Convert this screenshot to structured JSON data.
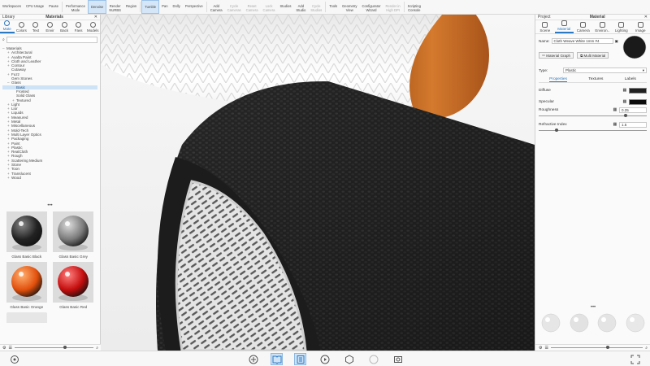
{
  "toolbar": {
    "items": [
      {
        "label": "Workspaces",
        "state": "normal"
      },
      {
        "label": "CPU Usage",
        "state": "normal"
      },
      {
        "label": "Pause",
        "state": "normal"
      },
      {
        "label": "Performance\nMode",
        "state": "normal"
      },
      {
        "label": "Denoise",
        "state": "active"
      },
      {
        "label": "Render\nNURBS",
        "state": "normal"
      },
      {
        "label": "Region",
        "state": "normal"
      },
      {
        "label": "Tumble",
        "state": "active"
      },
      {
        "label": "Pan",
        "state": "normal"
      },
      {
        "label": "Dolly",
        "state": "normal"
      },
      {
        "label": "Perspective",
        "state": "normal"
      },
      {
        "label": "Add\nCamera",
        "state": "normal"
      },
      {
        "label": "Cycle\nCameras",
        "state": "dim"
      },
      {
        "label": "Reset\nCamera",
        "state": "dim"
      },
      {
        "label": "Lock\nCamera",
        "state": "dim"
      },
      {
        "label": "Studios",
        "state": "normal"
      },
      {
        "label": "Add\nStudio",
        "state": "normal"
      },
      {
        "label": "Cycle\nStudios",
        "state": "dim"
      },
      {
        "label": "Tools",
        "state": "normal"
      },
      {
        "label": "Geometry\nView",
        "state": "normal"
      },
      {
        "label": "Configurator\nWizard",
        "state": "normal"
      },
      {
        "label": "Render in\nHigh DPI",
        "state": "dim"
      },
      {
        "label": "Scripting\nConsole",
        "state": "normal"
      }
    ]
  },
  "library": {
    "header": "Library",
    "title": "Materials",
    "tabs": [
      {
        "label": "Mate",
        "active": true
      },
      {
        "label": "Colors",
        "active": false
      },
      {
        "label": "Text",
        "active": false
      },
      {
        "label": "Envir",
        "active": false
      },
      {
        "label": "Back",
        "active": false
      },
      {
        "label": "Favs",
        "active": false
      },
      {
        "label": "Models",
        "active": false
      }
    ],
    "search_placeholder": "",
    "tree": [
      {
        "label": "Materials",
        "level": 0,
        "pm": "–",
        "sel": false
      },
      {
        "label": "Architectural",
        "level": 1,
        "pm": "+",
        "sel": false
      },
      {
        "label": "Axalta Paint",
        "level": 1,
        "pm": "+",
        "sel": false
      },
      {
        "label": "Cloth and Leather",
        "level": 1,
        "pm": "+",
        "sel": false
      },
      {
        "label": "Contour",
        "level": 1,
        "pm": "+",
        "sel": false
      },
      {
        "label": "Cutaway",
        "level": 1,
        "pm": "",
        "sel": false
      },
      {
        "label": "Fuzz",
        "level": 1,
        "pm": "+",
        "sel": false
      },
      {
        "label": "Gem Stones",
        "level": 1,
        "pm": "",
        "sel": false
      },
      {
        "label": "Glass",
        "level": 1,
        "pm": "–",
        "sel": false
      },
      {
        "label": "Basic",
        "level": 2,
        "pm": "",
        "sel": true
      },
      {
        "label": "Frosted",
        "level": 2,
        "pm": "",
        "sel": false
      },
      {
        "label": "Solid Glass",
        "level": 2,
        "pm": "",
        "sel": false
      },
      {
        "label": "Textured",
        "level": 2,
        "pm": "+",
        "sel": false
      },
      {
        "label": "Light",
        "level": 1,
        "pm": "+",
        "sel": false
      },
      {
        "label": "Lior",
        "level": 1,
        "pm": "+",
        "sel": false
      },
      {
        "label": "Liquids",
        "level": 1,
        "pm": "+",
        "sel": false
      },
      {
        "label": "Measured",
        "level": 1,
        "pm": "+",
        "sel": false
      },
      {
        "label": "Metal",
        "level": 1,
        "pm": "+",
        "sel": false
      },
      {
        "label": "Miscellaneous",
        "level": 1,
        "pm": "+",
        "sel": false
      },
      {
        "label": "Mold-Tech",
        "level": 1,
        "pm": "+",
        "sel": false
      },
      {
        "label": "Multi Layer Optics",
        "level": 1,
        "pm": "+",
        "sel": false
      },
      {
        "label": "Packaging",
        "level": 1,
        "pm": "+",
        "sel": false
      },
      {
        "label": "Paint",
        "level": 1,
        "pm": "+",
        "sel": false
      },
      {
        "label": "Plastic",
        "level": 1,
        "pm": "+",
        "sel": false
      },
      {
        "label": "RealCloth",
        "level": 1,
        "pm": "+",
        "sel": false
      },
      {
        "label": "Rough",
        "level": 1,
        "pm": "+",
        "sel": false
      },
      {
        "label": "Scattering Medium",
        "level": 1,
        "pm": "+",
        "sel": false
      },
      {
        "label": "Stone",
        "level": 1,
        "pm": "+",
        "sel": false
      },
      {
        "label": "Toon",
        "level": 1,
        "pm": "+",
        "sel": false
      },
      {
        "label": "Translucent",
        "level": 1,
        "pm": "+",
        "sel": false
      },
      {
        "label": "Wood",
        "level": 1,
        "pm": "+",
        "sel": false
      }
    ],
    "thumbs": [
      {
        "label": "Glass Basic Black",
        "color": "#222222",
        "hl": "#888888"
      },
      {
        "label": "Glass Basic Grey",
        "color": "#7a7a7a",
        "hl": "#dddddd"
      },
      {
        "label": "Glass Basic Orange",
        "color": "#e2500c",
        "hl": "#ffb070"
      },
      {
        "label": "Glass Basic Red",
        "color": "#c40d0d",
        "hl": "#ff8080"
      }
    ]
  },
  "project": {
    "header": "Project",
    "title": "Material",
    "tabs": [
      {
        "label": "Scene",
        "active": false
      },
      {
        "label": "Material",
        "active": true
      },
      {
        "label": "Camera",
        "active": false
      },
      {
        "label": "Environ..",
        "active": false
      },
      {
        "label": "Lighting",
        "active": false
      },
      {
        "label": "Image",
        "active": false
      }
    ],
    "name_label": "Name:",
    "name_value": "Cloth Weave White 1mm #4",
    "graph_button": "Material Graph",
    "multi_button": "Multi Material",
    "type_label": "Type:",
    "type_value": "Plastic",
    "subtabs": [
      "Properties",
      "Textures",
      "Labels"
    ],
    "props": {
      "diffuse_label": "Diffuse",
      "diffuse_color": "#1f1f1f",
      "specular_label": "Specular",
      "specular_color": "#0a0a0a",
      "roughness_label": "Roughness",
      "roughness_value": "0.25",
      "refractive_label": "Refractive Index",
      "refractive_value": "1.5"
    }
  },
  "colors": {
    "accent": "#2b79c2",
    "wood": "#c4651f",
    "fabric": "#232323"
  }
}
